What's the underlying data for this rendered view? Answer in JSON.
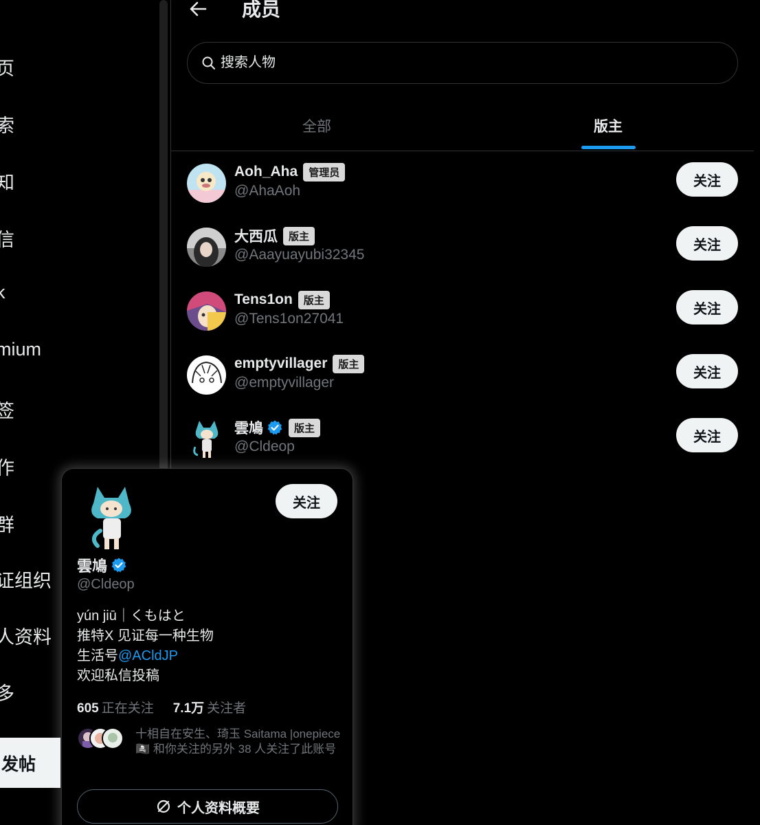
{
  "sidebar": {
    "items": [
      {
        "label": "页",
        "icon": "home-icon"
      },
      {
        "label": "索",
        "icon": "explore-icon"
      },
      {
        "label": "知",
        "icon": "notifications-icon"
      },
      {
        "label": "信",
        "icon": "messages-icon"
      },
      {
        "label": "k",
        "icon": "grok-icon"
      },
      {
        "label": "mium",
        "icon": "premium-icon"
      },
      {
        "label": "签",
        "icon": "bookmarks-icon"
      },
      {
        "label": "作",
        "icon": "jobs-icon"
      },
      {
        "label": "群",
        "icon": "communities-icon"
      },
      {
        "label": "证组织",
        "icon": "verified-orgs-icon"
      },
      {
        "label": "人资料",
        "icon": "profile-icon"
      },
      {
        "label": "多",
        "icon": "more-icon"
      }
    ],
    "post_label": "发帖"
  },
  "header": {
    "title": "成员"
  },
  "search": {
    "placeholder": "搜索人物"
  },
  "tabs": [
    {
      "label": "全部",
      "active": false
    },
    {
      "label": "版主",
      "active": true
    }
  ],
  "members": [
    {
      "name": "Aoh_Aha",
      "handle": "@AhaAoh",
      "badge": "管理员",
      "verified": false,
      "follow_label": "关注"
    },
    {
      "name": "大西瓜",
      "handle": "@Aaayuayubi32345",
      "badge": "版主",
      "verified": false,
      "follow_label": "关注"
    },
    {
      "name": "Tens1on",
      "handle": "@Tens1on27041",
      "badge": "版主",
      "verified": false,
      "follow_label": "关注"
    },
    {
      "name": "emptyvillager",
      "handle": "@emptyvillager",
      "badge": "版主",
      "verified": false,
      "follow_label": "关注"
    },
    {
      "name": "雲鳩",
      "handle": "@Cldeop",
      "badge": "版主",
      "verified": true,
      "follow_label": "关注"
    }
  ],
  "hovercard": {
    "name": "雲鳩",
    "handle": "@Cldeop",
    "follow_label": "关注",
    "bio_line1": "yún jiū｜くもはと",
    "bio_line2": "推特X 见证每一种生物",
    "bio_line3_prefix": "生活号",
    "bio_line3_link": "@ACldJP",
    "bio_line4": "欢迎私信投稿",
    "following_count": "605",
    "following_label": "正在关注",
    "followers_count": "7.1万",
    "followers_label": "关注者",
    "mutual_text": "十相自在安生、琦玉 Saitama |onepiece🏴‍☠️ 和你关注的另外 38 人关注了此账号",
    "profile_summary_label": "个人资料概要"
  },
  "colors": {
    "background": "#000000",
    "accent": "#1d9bf0",
    "muted_text": "#71767b",
    "button_light": "#eff3f4"
  }
}
